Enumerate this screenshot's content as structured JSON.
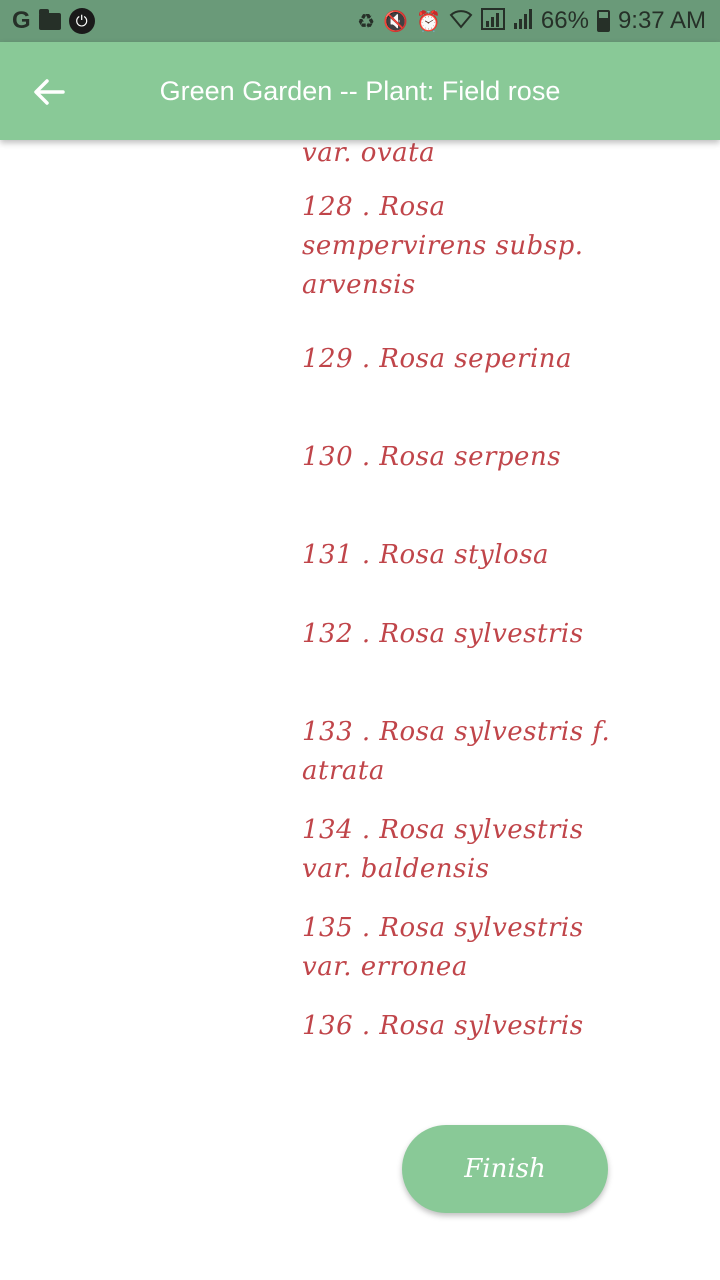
{
  "status_bar": {
    "battery": "66%",
    "time": "9:37 AM",
    "left_icons": [
      "google-icon",
      "folder-icon",
      "power-icon"
    ],
    "right_icons": [
      "recycle-icon",
      "mute-icon",
      "alarm-icon",
      "wifi-icon",
      "signal-icon",
      "signal-icon",
      "battery-icon"
    ]
  },
  "app_bar": {
    "title": "Green Garden -- Plant: Field rose",
    "background": "#89c997"
  },
  "plants": [
    {
      "text": "var. ovata"
    },
    {
      "text": "128 . Rosa sempervirens subsp. arvensis"
    },
    {
      "text": "129 . Rosa seperina"
    },
    {
      "text": "130 . Rosa serpens"
    },
    {
      "text": "131 . Rosa stylosa"
    },
    {
      "text": "132 . Rosa sylvestris"
    },
    {
      "text": "133 . Rosa sylvestris f. atrata"
    },
    {
      "text": "134 . Rosa sylvestris var. baldensis"
    },
    {
      "text": "135 . Rosa sylvestris var. erronea"
    },
    {
      "text": "136 . Rosa sylvestris"
    }
  ],
  "finish_button": {
    "label": "Finish"
  },
  "colors": {
    "accent": "#89c997",
    "plant_text": "#c0454a",
    "status_bar": "#6a9a79"
  }
}
